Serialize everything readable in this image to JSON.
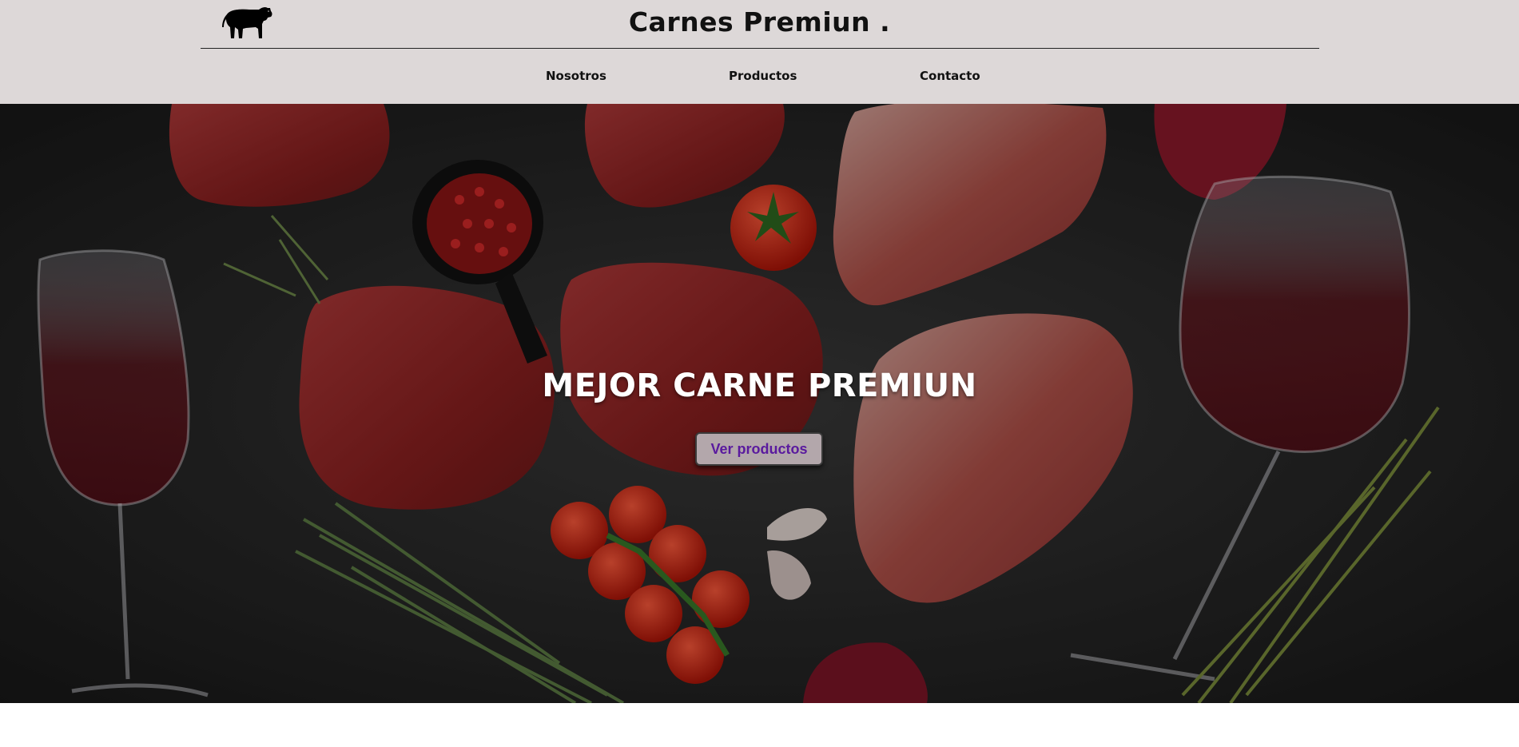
{
  "header": {
    "title": "Carnes Premiun .",
    "logo_icon": "cow-silhouette-icon",
    "nav": [
      {
        "label": "Nosotros"
      },
      {
        "label": "Productos"
      },
      {
        "label": "Contacto"
      }
    ]
  },
  "hero": {
    "heading": "MEJOR CARNE PREMIUN",
    "cta_label": "Ver productos",
    "background": "raw-steaks-wine-tomatoes-photo"
  },
  "colors": {
    "header_bg": "#ddd8d8",
    "button_bg": "#b3a7ab",
    "button_text": "#5a1a9e",
    "hero_bg": "#1f1f1f"
  }
}
